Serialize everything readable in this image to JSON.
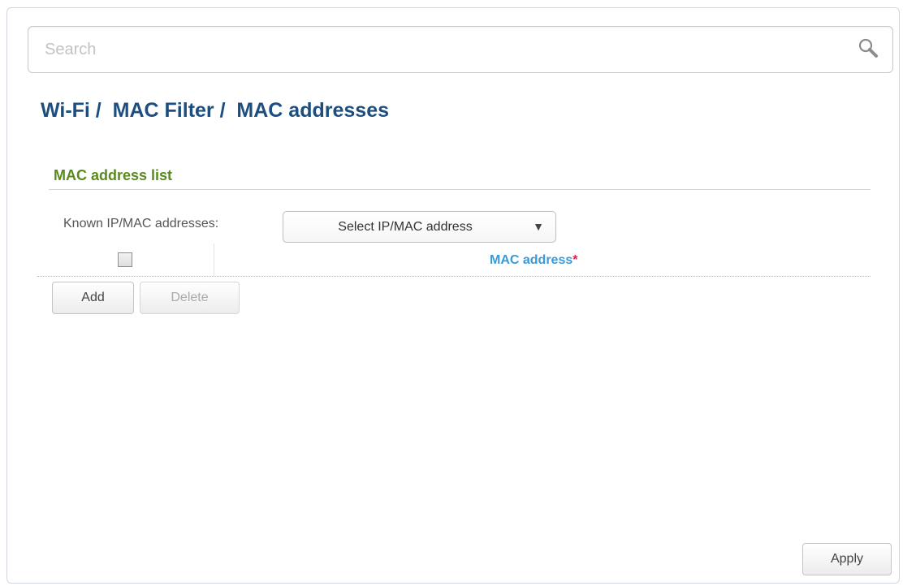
{
  "search": {
    "placeholder": "Search",
    "value": ""
  },
  "breadcrumb": {
    "text": "Wi-Fi /  MAC Filter /  MAC addresses",
    "items": [
      "Wi-Fi",
      "MAC Filter",
      "MAC addresses"
    ]
  },
  "section": {
    "title": "MAC address list"
  },
  "known": {
    "label": "Known IP/MAC addresses:",
    "select_value": "Select IP/MAC address",
    "arrow": "▼"
  },
  "table": {
    "columns": [
      {
        "label": "MAC address",
        "required_mark": "*"
      }
    ],
    "rows": []
  },
  "buttons": {
    "add": "Add",
    "delete": "Delete",
    "apply": "Apply"
  },
  "colors": {
    "breadcrumb": "#1c4e80",
    "section_title": "#5a8a1e",
    "column_header": "#3a9ad9",
    "required_mark": "#d0274c"
  },
  "icons": {
    "search": "search-icon"
  }
}
